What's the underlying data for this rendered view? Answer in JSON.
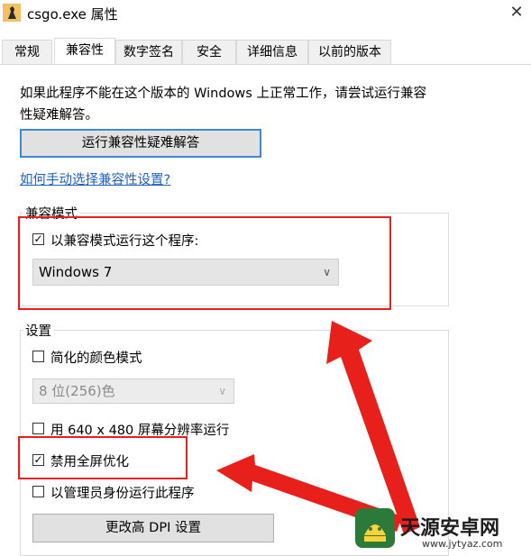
{
  "window": {
    "title": "csgo.exe 属性",
    "close_glyph": "✕"
  },
  "tabs": [
    {
      "label": "常规",
      "active": false
    },
    {
      "label": "兼容性",
      "active": true
    },
    {
      "label": "数字签名",
      "active": false
    },
    {
      "label": "安全",
      "active": false
    },
    {
      "label": "详细信息",
      "active": false
    },
    {
      "label": "以前的版本",
      "active": false
    }
  ],
  "compat_page": {
    "intro_line1": "如果此程序不能在这个版本的 Windows 上正常工作，请尝试运行兼容",
    "intro_line2": "性疑难解答。",
    "troubleshoot_label": "运行兼容性疑难解答",
    "manual_link": "如何手动选择兼容性设置?",
    "compat_mode": {
      "group_label": "兼容模式",
      "checkbox_label": "以兼容模式运行这个程序:",
      "checked": true,
      "selected_os": "Windows 7"
    },
    "settings": {
      "group_label": "设置",
      "reduced_color": {
        "label": "简化的颜色模式",
        "checked": false
      },
      "color_select": "8 位(256)色",
      "low_res": {
        "label": "用 640 x 480 屏幕分辨率运行",
        "checked": false
      },
      "disable_fullscreen": {
        "label": "禁用全屏优化",
        "checked": true
      },
      "run_as_admin": {
        "label": "以管理员身份运行此程序",
        "checked": false
      },
      "dpi_button": "更改高 DPI 设置"
    }
  },
  "watermark": {
    "name": "天源安卓网",
    "url": "www.jytyaz.com"
  },
  "colors": {
    "highlight": "#e8201c",
    "link": "#2060c0",
    "focus_border": "#3c8ad8"
  },
  "icons": [
    "app-icon",
    "close-icon",
    "chevron-down-icon",
    "check-icon",
    "android-logo-icon"
  ]
}
